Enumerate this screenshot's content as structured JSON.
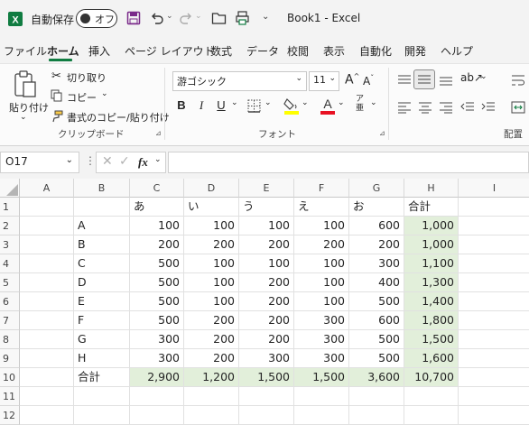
{
  "titlebar": {
    "autosave_label": "自動保存",
    "autosave_toggle": "オフ",
    "doc_title": "Book1 - Excel",
    "colors": {
      "excel_green": "#107c41",
      "save_purple": "#7a2a8a"
    },
    "icons": [
      "excel-logo-icon",
      "save-icon",
      "undo-icon",
      "redo-icon",
      "open-folder-icon",
      "print-preview-icon",
      "customize-qat-icon"
    ]
  },
  "menu": {
    "tabs": [
      "ファイル",
      "ホーム",
      "挿入",
      "ページ レイアウト",
      "数式",
      "データ",
      "校閲",
      "表示",
      "自動化",
      "開発",
      "ヘルプ"
    ],
    "active": "ホーム"
  },
  "ribbon": {
    "clipboard": {
      "paste": "貼り付け",
      "cut": "切り取り",
      "copy": "コピー",
      "format_painter": "書式のコピー/貼り付け",
      "group": "クリップボード"
    },
    "font": {
      "name": "游ゴシック",
      "size": "11",
      "bold": "B",
      "italic": "I",
      "underline": "U",
      "grow": "A",
      "shrink": "A",
      "group": "フォント",
      "colors": {
        "fill": "#ffff00",
        "font": "#e81123"
      }
    },
    "alignment": {
      "group": "配置"
    }
  },
  "formula": {
    "namebox": "O17",
    "fx": "fx",
    "value": ""
  },
  "sheet": {
    "columns": [
      "A",
      "B",
      "C",
      "D",
      "E",
      "F",
      "G",
      "H",
      "I"
    ],
    "row_numbers": [
      "1",
      "2",
      "3",
      "4",
      "5",
      "6",
      "7",
      "8",
      "9",
      "10",
      "11",
      "12"
    ],
    "header_row": [
      "",
      "",
      "あ",
      "い",
      "う",
      "え",
      "お",
      "合計",
      ""
    ],
    "rows": [
      [
        "",
        "A",
        "100",
        "100",
        "100",
        "100",
        "600",
        "1,000",
        ""
      ],
      [
        "",
        "B",
        "200",
        "200",
        "200",
        "200",
        "200",
        "1,000",
        ""
      ],
      [
        "",
        "C",
        "500",
        "100",
        "100",
        "100",
        "300",
        "1,100",
        ""
      ],
      [
        "",
        "D",
        "500",
        "100",
        "200",
        "100",
        "400",
        "1,300",
        ""
      ],
      [
        "",
        "E",
        "500",
        "100",
        "200",
        "100",
        "500",
        "1,400",
        ""
      ],
      [
        "",
        "F",
        "500",
        "200",
        "200",
        "300",
        "600",
        "1,800",
        ""
      ],
      [
        "",
        "G",
        "300",
        "200",
        "200",
        "300",
        "500",
        "1,500",
        ""
      ],
      [
        "",
        "H",
        "300",
        "200",
        "300",
        "300",
        "500",
        "1,600",
        ""
      ]
    ],
    "total_row": [
      "",
      "合計",
      "2,900",
      "1,200",
      "1,500",
      "1,500",
      "3,600",
      "10,700",
      ""
    ],
    "highlight_color": "#e2efda"
  }
}
